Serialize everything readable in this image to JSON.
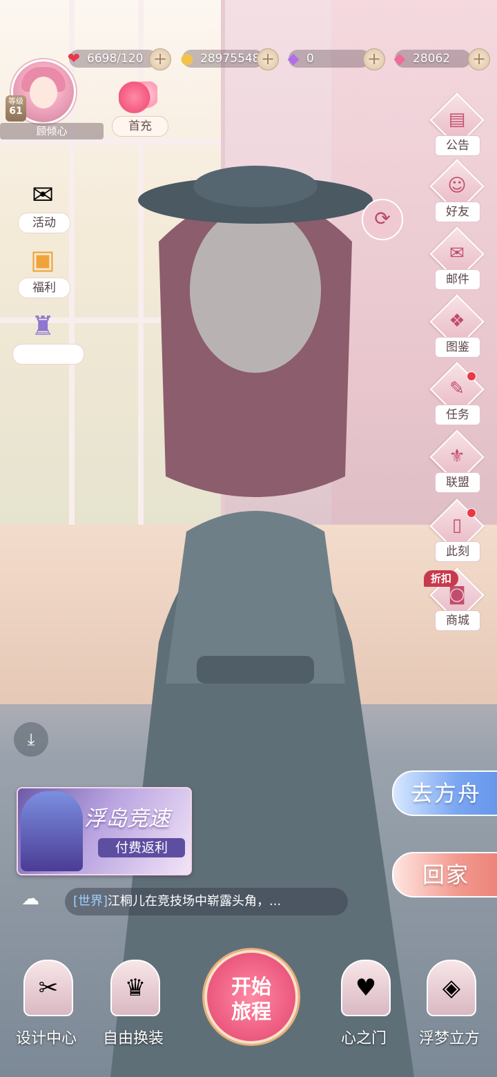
{
  "resources": [
    {
      "icon": "heart-icon",
      "value": "6698/120",
      "color": "#e8384f"
    },
    {
      "icon": "cat-coin-icon",
      "value": "28975548",
      "color": "#f2c14e"
    },
    {
      "icon": "purple-diamond-icon",
      "value": "0",
      "color": "#b06ee8"
    },
    {
      "icon": "pink-diamond-icon",
      "value": "28062",
      "color": "#f06a9a"
    }
  ],
  "player": {
    "level_label": "等级",
    "level": "61",
    "name": "顾倾心"
  },
  "first_charge": {
    "label": "首充"
  },
  "left_menu": [
    {
      "icon": "activity-icon",
      "label": "活动"
    },
    {
      "icon": "gift-box-icon",
      "label": "福利"
    },
    {
      "icon": "castle-icon",
      "label": ""
    }
  ],
  "right_menu": [
    {
      "icon": "announcement-icon",
      "label": "公告",
      "badge": false
    },
    {
      "icon": "friends-icon",
      "label": "好友",
      "badge": false
    },
    {
      "icon": "mail-icon",
      "label": "邮件",
      "badge": false
    },
    {
      "icon": "collection-icon",
      "label": "图鉴",
      "badge": false
    },
    {
      "icon": "task-icon",
      "label": "任务",
      "badge": true
    },
    {
      "icon": "alliance-icon",
      "label": "联盟",
      "badge": false
    },
    {
      "icon": "phone-icon",
      "label": "此刻",
      "badge": true
    },
    {
      "icon": "shop-bag-icon",
      "label": "商城",
      "badge": false
    }
  ],
  "discount_tag": "折扣",
  "event": {
    "title": "浮岛竞速",
    "subtitle": "付费返利"
  },
  "chat": {
    "channel": "[世界]",
    "message": "江桐儿在竞技场中崭露头角，..."
  },
  "actions": {
    "go_ark": "去方舟",
    "go_home": "回家"
  },
  "bottom_nav": {
    "design": "设计中心",
    "dressup": "自由换装",
    "start_line1": "开始",
    "start_line2": "旅程",
    "heart_door": "心之门",
    "dream_cube": "浮梦立方"
  }
}
